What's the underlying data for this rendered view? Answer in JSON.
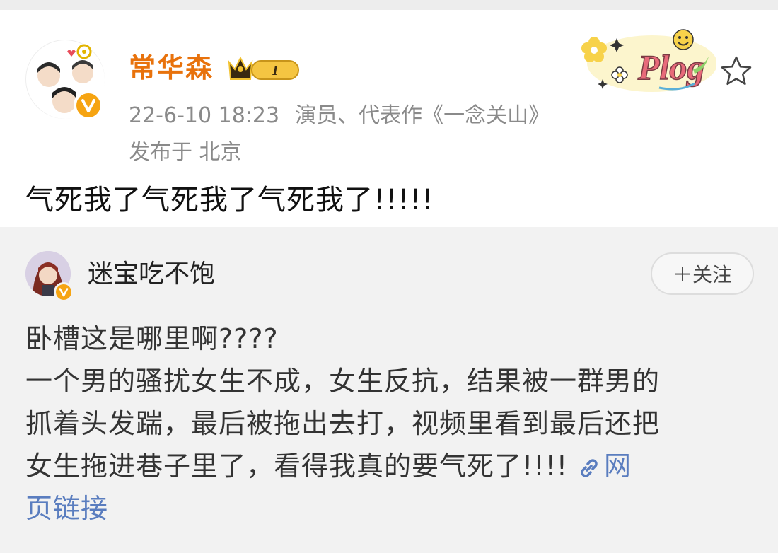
{
  "post": {
    "username": "常华森",
    "vip_level": "I",
    "time": "22-6-10 18:23",
    "bio": "演员、代表作《一念关山》",
    "location": "发布于 北京",
    "text": "气死我了气死我了气死我了!!!!!",
    "decoration_text": "Plog"
  },
  "repost": {
    "username": "迷宝吃不饱",
    "follow_label": "＋关注",
    "lines": [
      "卧槽这是哪里啊????",
      "一个男的骚扰女生不成，女生反抗，结果被一群男的",
      "抓着头发踹，最后被拖出去打，视频里看到最后还把",
      "女生拖进巷子里了，看得我真的要气死了!!!! "
    ],
    "link_label_1": "网",
    "link_label_2": "页链接"
  },
  "icons": {
    "verified": "verified-v-icon",
    "crown": "vip-crown-icon",
    "star": "star-outline-icon",
    "link": "link-icon"
  },
  "colors": {
    "username": "#e8720c",
    "verified": "#f6a412",
    "link": "#5a7dbf",
    "meta": "#8a8a8a",
    "repost_bg": "#f2f2f2"
  }
}
